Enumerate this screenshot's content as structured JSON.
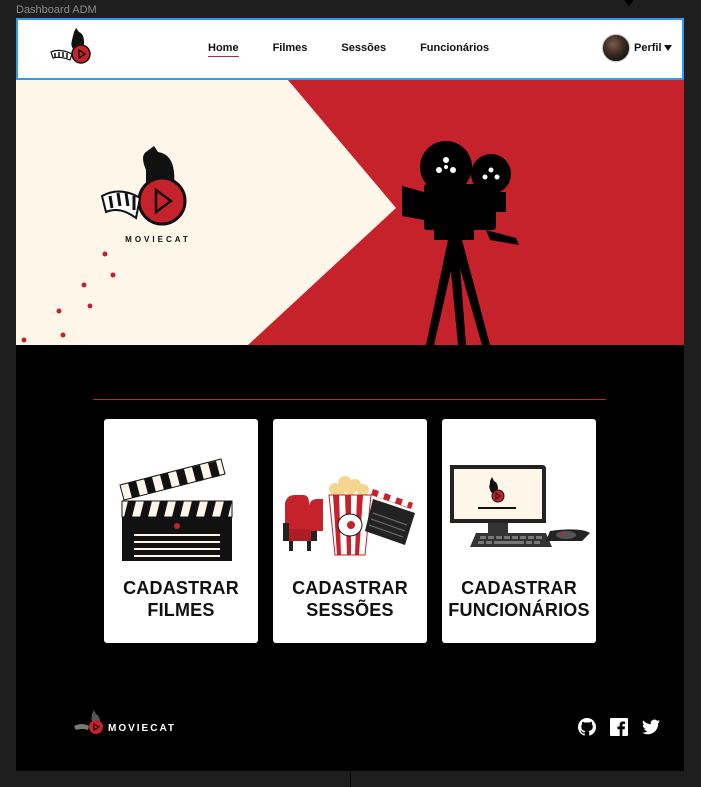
{
  "frame": {
    "label": "Dashboard ADM"
  },
  "header": {
    "nav": [
      {
        "label": "Home",
        "active": true
      },
      {
        "label": "Filmes",
        "active": false
      },
      {
        "label": "Sessões",
        "active": false
      },
      {
        "label": "Funcionários",
        "active": false
      }
    ],
    "profile": {
      "label": "Perfil",
      "caret": "caret-down-icon"
    }
  },
  "hero": {
    "brand": "MOVIECAT",
    "colors": {
      "cream": "#fdf6e9",
      "red": "#c6222b",
      "black": "#000000"
    }
  },
  "cards": [
    {
      "title_line1": "CADASTRAR",
      "title_line2": "FILMES",
      "icon": "clapperboard-icon"
    },
    {
      "title_line1": "CADASTRAR",
      "title_line2": "SESSÕES",
      "icon": "cinema-seats-popcorn-icon"
    },
    {
      "title_line1": "CADASTRAR",
      "title_line2": "FUNCIONÁRIOS",
      "icon": "computer-icon"
    }
  ],
  "footer": {
    "brand": "MOVIECAT",
    "social": [
      {
        "name": "github-icon"
      },
      {
        "name": "facebook-icon"
      },
      {
        "name": "twitter-icon"
      }
    ]
  }
}
